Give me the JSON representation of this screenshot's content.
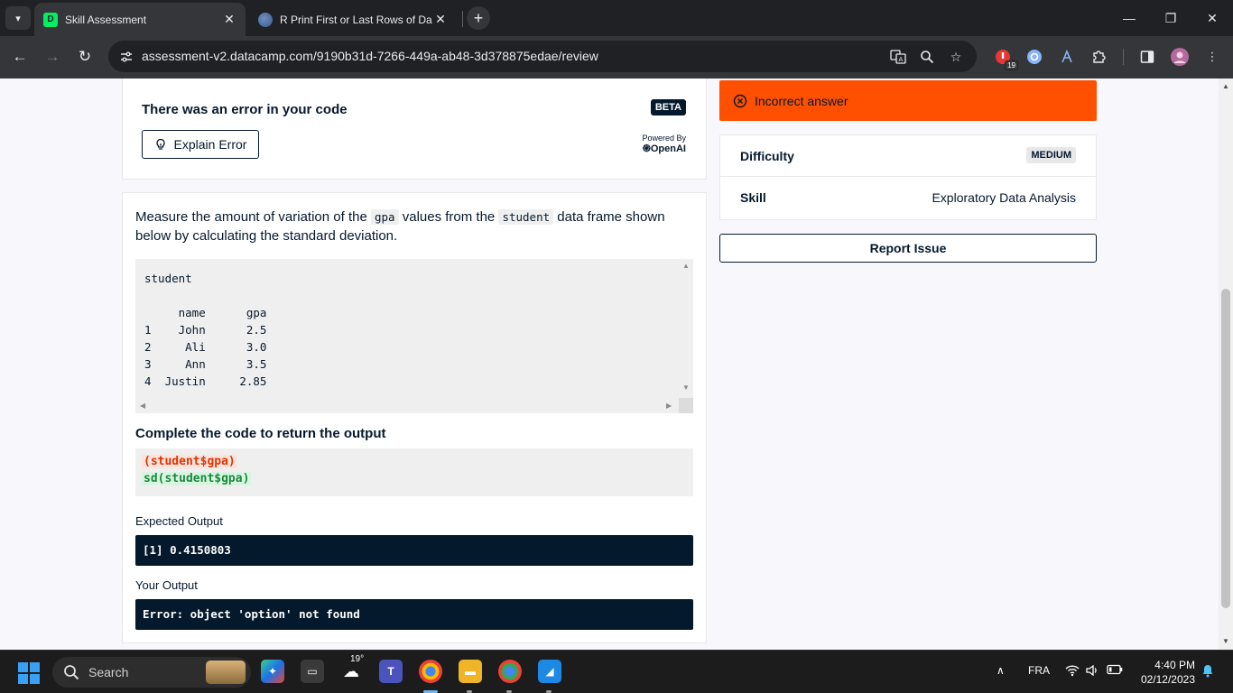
{
  "browser": {
    "tabs": [
      {
        "title": "Skill Assessment",
        "active": true
      },
      {
        "title": "R Print First or Last Rows of Da",
        "active": false
      }
    ],
    "url": "assessment-v2.datacamp.com/9190b31d-7266-449a-ab48-3d378875edae/review",
    "extension_badge": "19"
  },
  "error_card": {
    "title": "There was an error in your code",
    "beta_label": "BETA",
    "explain_button": "Explain Error",
    "powered_by": "Powered By",
    "powered_brand": "OpenAI"
  },
  "question": {
    "text_part1": "Measure the amount of variation of the ",
    "code1": "gpa",
    "text_part2": " values from the ",
    "code2": "student",
    "text_part3": " data frame shown below by calculating the standard deviation.",
    "table_text": "student\n\n     name      gpa\n1    John      2.5\n2     Ali      3.0\n3     Ann      3.5\n4  Justin     2.85",
    "complete_heading": "Complete the code to return the output",
    "code_wrong": "(student$gpa)",
    "code_right": "sd(student$gpa)",
    "expected_label": "Expected Output",
    "expected_output": "[1] 0.4150803",
    "your_label": "Your Output",
    "your_output": "Error: object 'option' not found"
  },
  "result": {
    "status": "Incorrect answer",
    "difficulty_key": "Difficulty",
    "difficulty_value": "MEDIUM",
    "skill_key": "Skill",
    "skill_value": "Exploratory Data Analysis",
    "report_button": "Report Issue"
  },
  "taskbar": {
    "search_label": "Search",
    "weather_temp": "19°",
    "language": "FRA",
    "time": "4:40 PM",
    "date": "02/12/2023"
  },
  "colors": {
    "incorrect_bg": "#fe5000",
    "navy": "#05192d",
    "chrome_dark": "#202124"
  }
}
